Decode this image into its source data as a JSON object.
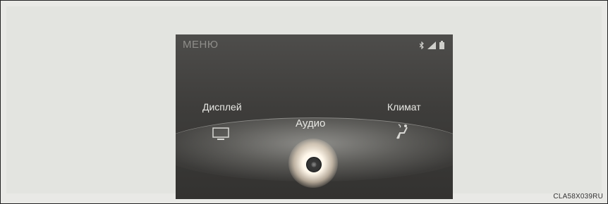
{
  "screen": {
    "title": "МЕНЮ",
    "status_icons": [
      "bluetooth-icon",
      "signal-icon",
      "battery-icon"
    ],
    "items": [
      {
        "label": "Дисплей",
        "icon": "display-icon"
      },
      {
        "label": "Аудио",
        "icon": "audio-disc-icon",
        "selected": true
      },
      {
        "label": "Климат",
        "icon": "climate-seat-icon"
      }
    ]
  },
  "caption": "CLA58X039RU",
  "colors": {
    "screen_bg": "#3e3d3b",
    "glow": "#fff7ea",
    "text": "#e8e8e4"
  }
}
